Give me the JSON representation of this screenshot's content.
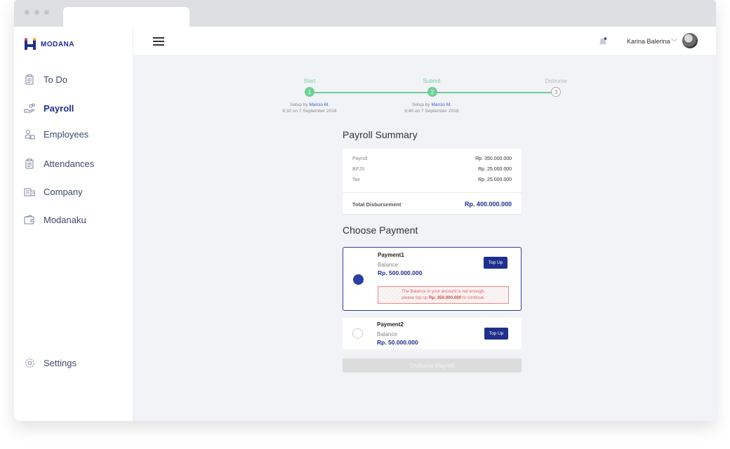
{
  "app": {
    "brand": "MODANA"
  },
  "sidebar": {
    "items": [
      {
        "label": "To Do",
        "icon": "clipboard-icon"
      },
      {
        "label": "Payroll",
        "icon": "hand-coins-icon",
        "active": true
      },
      {
        "label": "Employees",
        "icon": "people-icon"
      },
      {
        "label": "Attendances",
        "icon": "clipboard-icon"
      },
      {
        "label": "Company",
        "icon": "building-icon"
      },
      {
        "label": "Modanaku",
        "icon": "wallet-icon"
      }
    ],
    "settings_label": "Settings"
  },
  "header": {
    "user_name": "Karina Balerina"
  },
  "stepper": {
    "steps": [
      {
        "label": "Start",
        "number": "1",
        "info_prefix": "Setup by",
        "info_name": "Marcio M.",
        "info_time": "6:30 on 7 September 2018",
        "state": "done"
      },
      {
        "label": "Submit",
        "number": "2",
        "info_prefix": "Setup by",
        "info_name": "Marcio M.",
        "info_time": "6:40 on 7 September 2018",
        "state": "done"
      },
      {
        "label": "Disburse",
        "number": "3",
        "state": "pending"
      }
    ]
  },
  "summary": {
    "title": "Payroll Summary",
    "rows": [
      {
        "label": "Payroll",
        "value": "Rp. 350.000.000"
      },
      {
        "label": "BPJS",
        "value": "Rp.  25.000.000"
      },
      {
        "label": "Tax",
        "value": "Rp.  25.000.000"
      }
    ],
    "total_label": "Total Disbursement",
    "total_value": "Rp. 400.000.000"
  },
  "payment": {
    "title": "Choose Payment",
    "options": [
      {
        "name": "Payment1",
        "balance_label": "Balance",
        "balance": "Rp. 500.000.000",
        "topup_label": "Top Up",
        "selected": true,
        "warning_1": "The Balance in your account is not enough,",
        "warning_2a": "please top up",
        "warning_amount": "Rp. 350.000.000",
        "warning_2b": "to continue."
      },
      {
        "name": "Payment2",
        "balance_label": "Balance",
        "balance": "Rp. 50.000.000",
        "topup_label": "Top Up",
        "selected": false
      }
    ],
    "disburse_label": "Disburse Payroll"
  },
  "colors": {
    "primary": "#1e2f8c",
    "step_done": "#6fcf97",
    "warning": "#e06666"
  }
}
